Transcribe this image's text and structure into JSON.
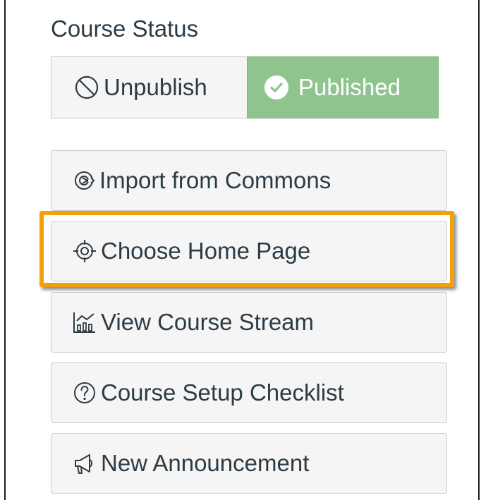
{
  "course_status": {
    "title": "Course Status",
    "unpublish_label": "Unpublish",
    "published_label": "Published"
  },
  "actions": {
    "import_label": "Import from Commons",
    "home_page_label": "Choose Home Page",
    "stream_label": "View Course Stream",
    "checklist_label": "Course Setup Checklist",
    "announcement_label": "New Announcement"
  },
  "colors": {
    "published_green": "#8fc48f",
    "highlight_orange": "#f3a10a",
    "text": "#2d3b45"
  },
  "icons": {
    "unpublish": "circle-slash-icon",
    "published": "check-circle-icon",
    "import": "commons-icon",
    "home_page": "target-icon",
    "stream": "stream-chart-icon",
    "checklist": "question-circle-icon",
    "announcement": "megaphone-icon"
  }
}
